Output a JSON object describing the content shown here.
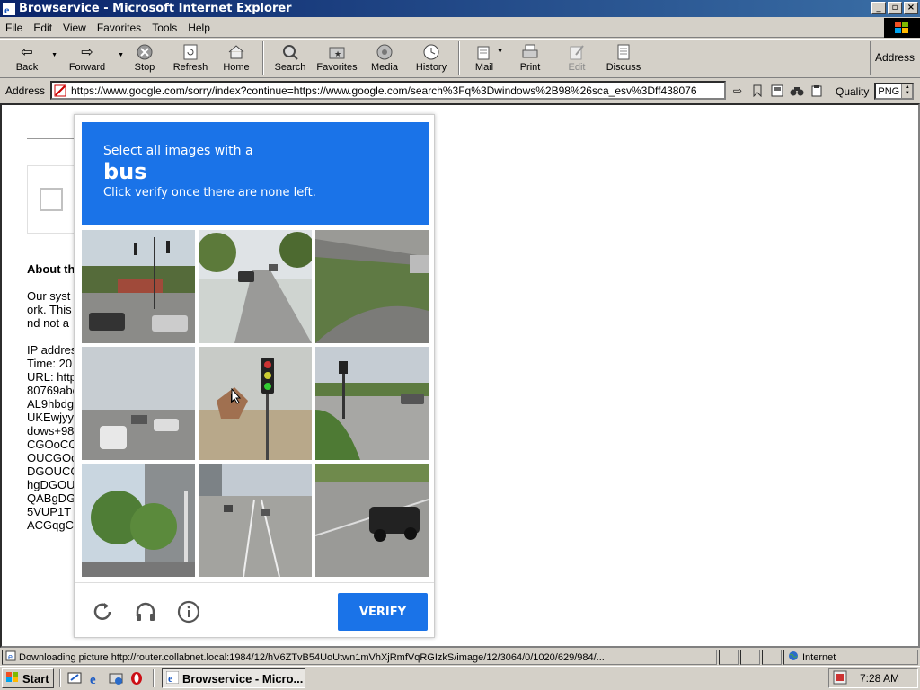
{
  "window": {
    "title": "Browservice - Microsoft Internet Explorer",
    "buttons": {
      "minimize": "_",
      "maximize": "▫",
      "close": "×"
    }
  },
  "menu": [
    "File",
    "Edit",
    "View",
    "Favorites",
    "Tools",
    "Help"
  ],
  "toolbar": {
    "back": "Back",
    "forward": "Forward",
    "stop": "Stop",
    "refresh": "Refresh",
    "home": "Home",
    "search": "Search",
    "favorites": "Favorites",
    "media": "Media",
    "history": "History",
    "mail": "Mail",
    "print": "Print",
    "edit": "Edit",
    "discuss": "Discuss",
    "address_right": "Address"
  },
  "address": {
    "label": "Address",
    "url": "https://www.google.com/sorry/index?continue=https://www.google.com/search%3Fq%3Dwindows%2B98%26sca_esv%3Dff438076",
    "quality_label": "Quality",
    "quality_value": "PNG"
  },
  "background": {
    "about": "About th",
    "lines": [
      "Our syst",
      "ork. This",
      "nd not a"
    ],
    "ip_lines": [
      "IP addres",
      "Time: 20",
      "URL: http",
      "80769abe",
      "AL9hbdg",
      "UKEwjyy",
      "dows+98",
      "CGOoCC",
      "OUCGOo",
      "DGOUCC",
      "hgDGOU",
      "QABgDG",
      "5VUP1T",
      "ACGqgC"
    ]
  },
  "captcha": {
    "instruction": "Select all images with a",
    "target": "bus",
    "hint": "Click verify once there are none left.",
    "verify_label": "VERIFY",
    "accent": "#1a73e8"
  },
  "status": {
    "text": "Downloading picture http://router.collabnet.local:1984/12/hV6ZTvB54UoUtwn1mVhXjRmfVqRGIzkS/image/12/3064/0/1020/629/984/...",
    "zone": "Internet"
  },
  "taskbar": {
    "start": "Start",
    "task": "Browservice - Micro...",
    "clock": "7:28 AM"
  }
}
